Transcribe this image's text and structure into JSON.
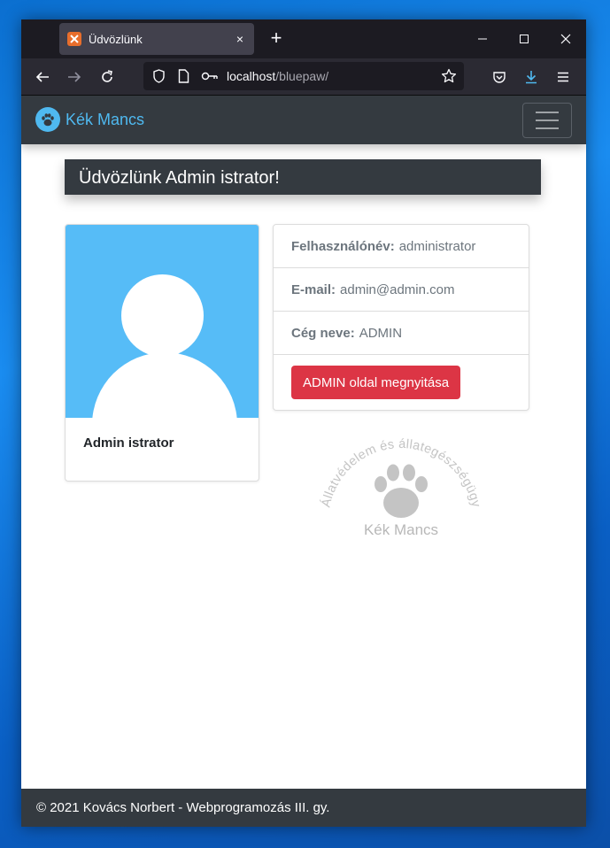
{
  "browser": {
    "tab_title": "Üdvözlünk",
    "tab_close": "×",
    "new_tab": "+",
    "url_host": "localhost",
    "url_path": "/bluepaw/"
  },
  "site": {
    "brand": "Kék Mancs",
    "brand_color": "#4fb9f0",
    "welcome": "Üdvözlünk Admin istrator!"
  },
  "profile": {
    "name": "Admin istrator",
    "avatar_color": "#56bcf7"
  },
  "info": {
    "username_label": "Felhasználónév:",
    "username": "administrator",
    "email_label": "E-mail:",
    "email": "admin@admin.com",
    "company_label": "Cég neve:",
    "company": "ADMIN",
    "admin_button": "ADMIN oldal megnyitása",
    "button_color": "#dc3545"
  },
  "watermark": {
    "arc_text": "Állatvédelem és állategészségügy",
    "brand": "Kék Mancs"
  },
  "footer": {
    "text": "© 2021 Kovács Norbert - Webprogramozás III. gy."
  }
}
